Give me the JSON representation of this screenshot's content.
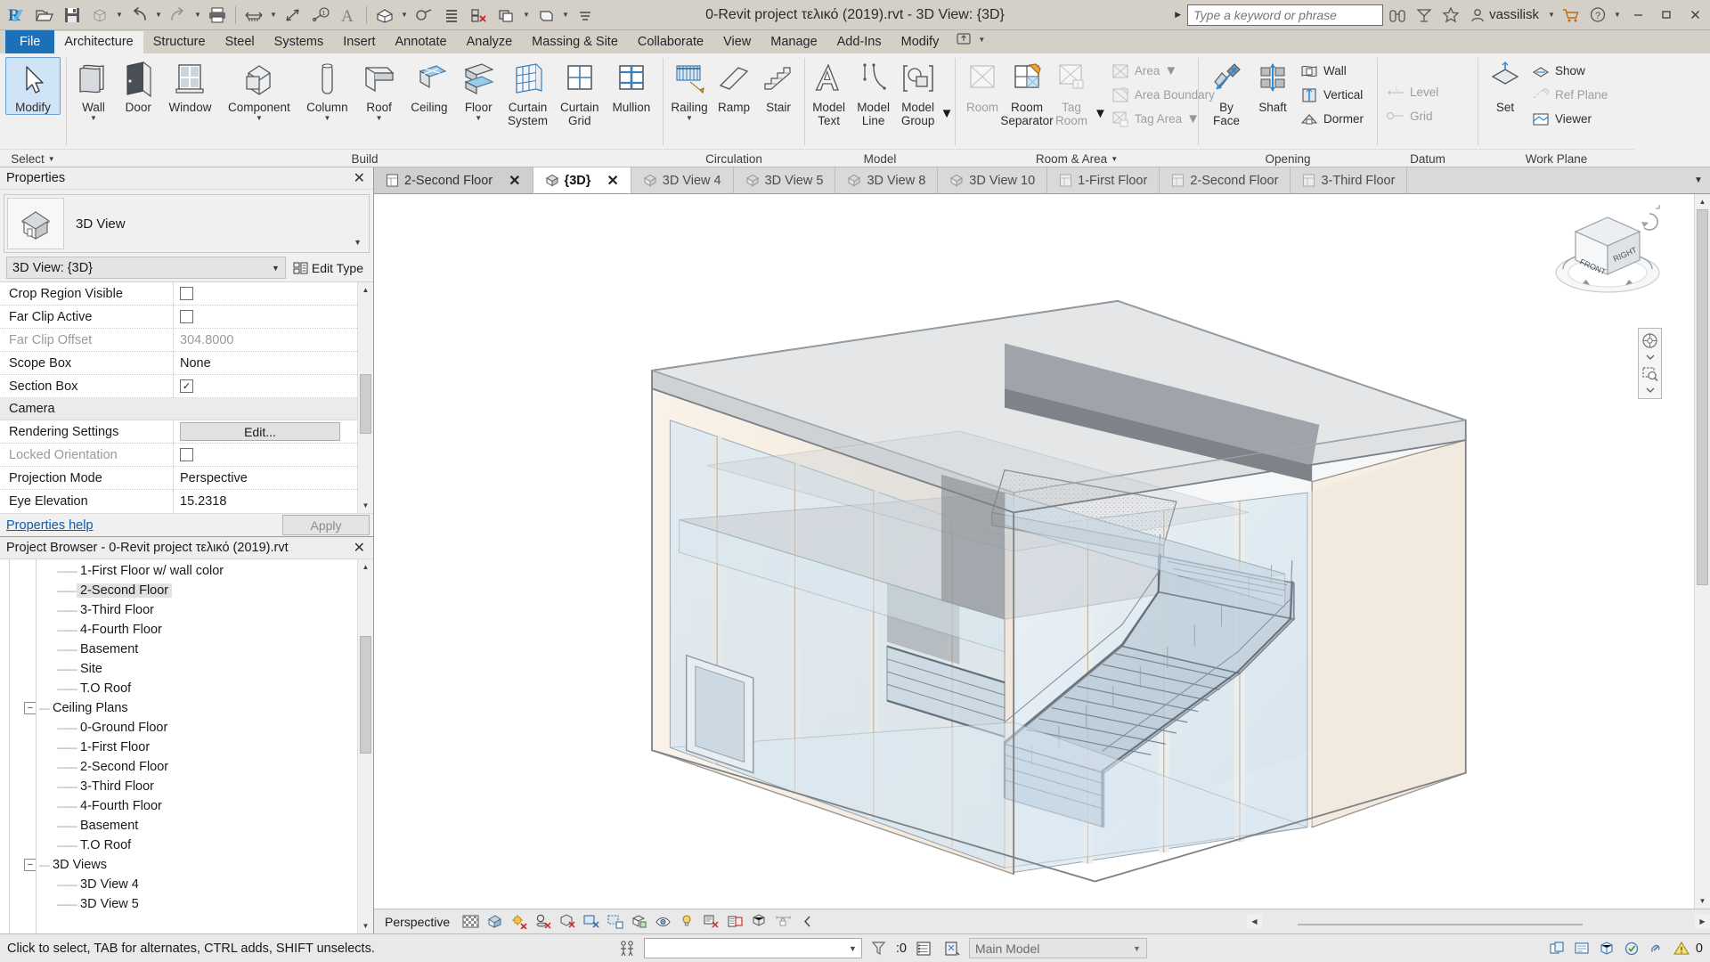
{
  "titlebar": {
    "app_title": "0-Revit project τελικό (2019).rvt - 3D View: {3D}",
    "quick_access": [
      {
        "name": "revit-logo-icon",
        "label": "R"
      },
      {
        "name": "open-icon",
        "label": "Open"
      },
      {
        "name": "save-icon",
        "label": "Save"
      },
      {
        "name": "save-as-icon",
        "label": "Save As"
      },
      {
        "name": "undo-icon",
        "label": "Undo"
      },
      {
        "name": "redo-icon",
        "label": "Redo"
      },
      {
        "name": "print-icon",
        "label": "Print"
      },
      {
        "name": "measure-icon",
        "label": "Measure"
      },
      {
        "name": "aligned-dimension-icon",
        "label": "Aligned Dimension"
      },
      {
        "name": "tag-by-category-icon",
        "label": "Tag by Category"
      },
      {
        "name": "text-icon",
        "label": "Text"
      },
      {
        "name": "default-3d-view-icon",
        "label": "Default 3D View"
      },
      {
        "name": "section-icon",
        "label": "Section"
      },
      {
        "name": "thin-lines-icon",
        "label": "Thin Lines"
      },
      {
        "name": "close-hidden-windows-icon",
        "label": "Close Hidden Windows"
      },
      {
        "name": "switch-windows-icon",
        "label": "Switch Windows"
      },
      {
        "name": "customize-qat-icon",
        "label": "Customize Quick Access Toolbar"
      }
    ],
    "search_placeholder": "Type a keyword or phrase",
    "help_icons": [
      {
        "name": "search-binoculars-icon"
      },
      {
        "name": "autodesk-app-store-icon"
      },
      {
        "name": "favorites-star-icon"
      }
    ],
    "user_name": "vassilisk",
    "user_icon": "user-account-icon",
    "cart_icon": "shopping-cart-icon",
    "help_icon": "help-question-icon",
    "window_buttons": [
      {
        "name": "minimize-button",
        "glyph": "—"
      },
      {
        "name": "restore-button",
        "glyph": "❐"
      },
      {
        "name": "close-button",
        "glyph": "✕"
      }
    ]
  },
  "ribbon_tabs": [
    {
      "label": "File",
      "state": "file"
    },
    {
      "label": "Architecture",
      "state": "active"
    },
    {
      "label": "Structure",
      "state": "normal"
    },
    {
      "label": "Steel",
      "state": "normal"
    },
    {
      "label": "Systems",
      "state": "normal"
    },
    {
      "label": "Insert",
      "state": "normal"
    },
    {
      "label": "Annotate",
      "state": "normal"
    },
    {
      "label": "Analyze",
      "state": "normal"
    },
    {
      "label": "Massing & Site",
      "state": "normal"
    },
    {
      "label": "Collaborate",
      "state": "normal"
    },
    {
      "label": "View",
      "state": "normal"
    },
    {
      "label": "Manage",
      "state": "normal"
    },
    {
      "label": "Add-Ins",
      "state": "normal"
    },
    {
      "label": "Modify",
      "state": "normal"
    }
  ],
  "ribbon": {
    "select_panel": {
      "label": "Select",
      "modify_label": "Modify",
      "modify_icon": "cursor-arrow-icon"
    },
    "build_panel": {
      "label": "Build",
      "buttons": [
        {
          "label": "Wall",
          "icon": "wall-icon",
          "dropdown": true
        },
        {
          "label": "Door",
          "icon": "door-icon",
          "dropdown": false
        },
        {
          "label": "Window",
          "icon": "window-icon",
          "dropdown": false
        },
        {
          "label": "Component",
          "icon": "component-icon",
          "dropdown": true
        },
        {
          "label": "Column",
          "icon": "column-icon",
          "dropdown": true
        },
        {
          "label": "Roof",
          "icon": "roof-icon",
          "dropdown": true
        },
        {
          "label": "Ceiling",
          "icon": "ceiling-icon",
          "dropdown": false
        },
        {
          "label": "Floor",
          "icon": "floor-icon",
          "dropdown": true
        },
        {
          "label": "Curtain\nSystem",
          "icon": "curtain-system-icon",
          "dropdown": false
        },
        {
          "label": "Curtain\nGrid",
          "icon": "curtain-grid-icon",
          "dropdown": false
        },
        {
          "label": "Mullion",
          "icon": "mullion-icon",
          "dropdown": false
        }
      ]
    },
    "circulation_panel": {
      "label": "Circulation",
      "buttons": [
        {
          "label": "Railing",
          "icon": "railing-icon",
          "dropdown": true
        },
        {
          "label": "Ramp",
          "icon": "ramp-icon",
          "dropdown": false
        },
        {
          "label": "Stair",
          "icon": "stair-icon",
          "dropdown": false
        }
      ]
    },
    "model_panel": {
      "label": "Model",
      "buttons": [
        {
          "label": "Model\nText",
          "icon": "model-text-icon",
          "dropdown": false
        },
        {
          "label": "Model\nLine",
          "icon": "model-line-icon",
          "dropdown": false
        },
        {
          "label": "Model\nGroup",
          "icon": "model-group-icon",
          "dropdown": true
        }
      ]
    },
    "room_area_panel": {
      "label": "Room & Area",
      "dropdown": true,
      "buttons": [
        {
          "label": "Room",
          "icon": "room-icon",
          "dropdown": false,
          "disabled": true
        },
        {
          "label": "Room\nSeparator",
          "icon": "room-separator-icon",
          "dropdown": false,
          "disabled": false
        },
        {
          "label": "Tag\nRoom",
          "icon": "tag-room-icon",
          "dropdown": true,
          "disabled": true
        }
      ],
      "small_buttons": [
        {
          "label": "Area",
          "icon": "area-icon",
          "dropdown": true,
          "disabled": true
        },
        {
          "label": "Area Boundary",
          "icon": "area-boundary-icon",
          "dropdown": false,
          "disabled": true
        },
        {
          "label": "Tag Area",
          "icon": "tag-area-icon",
          "dropdown": true,
          "disabled": true
        }
      ]
    },
    "opening_panel": {
      "label": "Opening",
      "buttons": [
        {
          "label": "By\nFace",
          "icon": "opening-by-face-icon"
        },
        {
          "label": "Shaft",
          "icon": "shaft-opening-icon"
        }
      ],
      "small_buttons": [
        {
          "label": "Wall",
          "icon": "wall-opening-icon",
          "disabled": false
        },
        {
          "label": "Vertical",
          "icon": "vertical-opening-icon",
          "disabled": false
        },
        {
          "label": "Dormer",
          "icon": "dormer-opening-icon",
          "disabled": false
        }
      ]
    },
    "datum_panel": {
      "label": "Datum",
      "small_buttons": [
        {
          "label": "Level",
          "icon": "level-icon",
          "disabled": true
        },
        {
          "label": "Grid",
          "icon": "grid-icon",
          "disabled": true
        }
      ]
    },
    "workplane_panel": {
      "label": "Work Plane",
      "set_label": "Set",
      "set_icon": "set-work-plane-icon",
      "small_buttons": [
        {
          "label": "Show",
          "icon": "show-work-plane-icon",
          "disabled": false
        },
        {
          "label": "Ref Plane",
          "icon": "reference-plane-icon",
          "disabled": true
        },
        {
          "label": "Viewer",
          "icon": "work-plane-viewer-icon",
          "disabled": false
        }
      ]
    }
  },
  "properties": {
    "title": "Properties",
    "close_icon": "close-icon",
    "family_type": "3D View",
    "family_icon": "3d-view-thumbnail-icon",
    "type_selector": "3D View: {3D}",
    "edit_type_label": "Edit Type",
    "edit_type_icon": "edit-type-icon",
    "rows": [
      {
        "key": "Crop Region Visible",
        "type": "checkbox",
        "checked": false,
        "dim": false
      },
      {
        "key": "Far Clip Active",
        "type": "checkbox",
        "checked": false,
        "dim": false
      },
      {
        "key": "Far Clip Offset",
        "type": "text",
        "value": "304.8000",
        "dim": true
      },
      {
        "key": "Scope Box",
        "type": "text",
        "value": "None",
        "dim": false
      },
      {
        "key": "Section Box",
        "type": "checkbox",
        "checked": true,
        "dim": false
      }
    ],
    "group_label": "Camera",
    "camera_rows": [
      {
        "key": "Rendering Settings",
        "type": "button",
        "value": "Edit...",
        "dim": false
      },
      {
        "key": "Locked Orientation",
        "type": "checkbox",
        "checked": false,
        "dim": true
      },
      {
        "key": "Projection Mode",
        "type": "text",
        "value": "Perspective",
        "dim": false
      },
      {
        "key": "Eye Elevation",
        "type": "text",
        "value": "15.2318",
        "dim": false
      }
    ],
    "help_link": "Properties help",
    "apply_label": "Apply"
  },
  "project_browser": {
    "title": "Project Browser - 0-Revit project τελικό (2019).rvt",
    "close_icon": "close-icon",
    "nodes": [
      {
        "label": "1-First Floor w/ wall color",
        "depth": 3,
        "type": "leaf",
        "selected": false
      },
      {
        "label": "2-Second Floor",
        "depth": 3,
        "type": "leaf",
        "selected": true
      },
      {
        "label": "3-Third Floor",
        "depth": 3,
        "type": "leaf",
        "selected": false
      },
      {
        "label": "4-Fourth Floor",
        "depth": 3,
        "type": "leaf",
        "selected": false
      },
      {
        "label": "Basement",
        "depth": 3,
        "type": "leaf",
        "selected": false
      },
      {
        "label": "Site",
        "depth": 3,
        "type": "leaf",
        "selected": false
      },
      {
        "label": "T.O Roof",
        "depth": 3,
        "type": "leaf",
        "selected": false
      },
      {
        "label": "Ceiling Plans",
        "depth": 2,
        "type": "group",
        "expanded": true,
        "selected": false
      },
      {
        "label": "0-Ground Floor",
        "depth": 3,
        "type": "leaf",
        "selected": false
      },
      {
        "label": "1-First Floor",
        "depth": 3,
        "type": "leaf",
        "selected": false
      },
      {
        "label": "2-Second Floor",
        "depth": 3,
        "type": "leaf",
        "selected": false
      },
      {
        "label": "3-Third Floor",
        "depth": 3,
        "type": "leaf",
        "selected": false
      },
      {
        "label": "4-Fourth Floor",
        "depth": 3,
        "type": "leaf",
        "selected": false
      },
      {
        "label": "Basement",
        "depth": 3,
        "type": "leaf",
        "selected": false
      },
      {
        "label": "T.O Roof",
        "depth": 3,
        "type": "leaf",
        "selected": false
      },
      {
        "label": "3D Views",
        "depth": 2,
        "type": "group",
        "expanded": true,
        "selected": false
      },
      {
        "label": "3D View 4",
        "depth": 3,
        "type": "leaf",
        "selected": false
      },
      {
        "label": "3D View 5",
        "depth": 3,
        "type": "leaf",
        "selected": false
      }
    ]
  },
  "view_tabs": [
    {
      "label": "2-Second Floor",
      "icon": "floor-plan-tab-icon",
      "state": "prev",
      "closable": true
    },
    {
      "label": "{3D}",
      "icon": "3d-view-tab-icon",
      "state": "active",
      "closable": true
    },
    {
      "label": "3D View 4",
      "icon": "3d-view-tab-icon",
      "state": "inactive",
      "closable": false
    },
    {
      "label": "3D View 5",
      "icon": "3d-view-tab-icon",
      "state": "inactive",
      "closable": false
    },
    {
      "label": "3D View 8",
      "icon": "3d-view-tab-icon",
      "state": "inactive",
      "closable": false
    },
    {
      "label": "3D View 10",
      "icon": "3d-view-tab-icon",
      "state": "inactive",
      "closable": false
    },
    {
      "label": "1-First Floor",
      "icon": "floor-plan-tab-icon",
      "state": "inactive",
      "closable": false
    },
    {
      "label": "2-Second Floor",
      "icon": "floor-plan-tab-icon",
      "state": "inactive",
      "closable": false
    },
    {
      "label": "3-Third Floor",
      "icon": "floor-plan-tab-icon",
      "state": "inactive",
      "closable": false
    }
  ],
  "navcube": {
    "front_label": "FRONT",
    "right_label": "RIGHT"
  },
  "navbar_icons": [
    {
      "name": "steering-wheel-icon"
    },
    {
      "name": "navbar-dropdown-1-icon"
    },
    {
      "name": "zoom-region-icon"
    },
    {
      "name": "navbar-dropdown-2-icon"
    }
  ],
  "view_control_bar": {
    "mode": "Perspective",
    "icons": [
      {
        "name": "scale-icon"
      },
      {
        "name": "visual-style-icon"
      },
      {
        "name": "sun-path-icon"
      },
      {
        "name": "shadows-icon"
      },
      {
        "name": "rendering-dialog-icon"
      },
      {
        "name": "crop-view-icon"
      },
      {
        "name": "show-crop-region-icon"
      },
      {
        "name": "lock-3d-view-icon"
      },
      {
        "name": "temporary-hide-isolate-icon"
      },
      {
        "name": "reveal-hidden-elements-icon"
      },
      {
        "name": "worksharing-display-icon"
      },
      {
        "name": "temporary-view-properties-icon"
      },
      {
        "name": "analytical-model-icon"
      },
      {
        "name": "constraints-icon"
      },
      {
        "name": "expand-arrow-icon"
      }
    ]
  },
  "statusbar": {
    "hint": "Click to select, TAB for alternates, CTRL adds, SHIFT unselects.",
    "press_select_icon": "press-and-drag-icon",
    "filter_value": "",
    "filter_icon": "filter-icon",
    "selection_count": ":0",
    "design_options_icon": "design-options-icon",
    "exclude_options_icon": "exclude-options-icon",
    "workset": "Main Model",
    "right_icons": [
      {
        "name": "worksets-icon"
      },
      {
        "name": "editing-requests-icon"
      },
      {
        "name": "design-options-status-icon"
      },
      {
        "name": "active-option-icon"
      },
      {
        "name": "select-link-icon"
      },
      {
        "name": "warnings-icon"
      }
    ],
    "warning_count": "0"
  },
  "colors": {
    "titlebar_bg": "#d4d0c8",
    "ribbon_bg": "#f0f0f0",
    "file_tab": "#1b70b8",
    "accent_blue": "#3c7fc0",
    "link": "#0b5cab",
    "selection": "#e2e2e2"
  }
}
